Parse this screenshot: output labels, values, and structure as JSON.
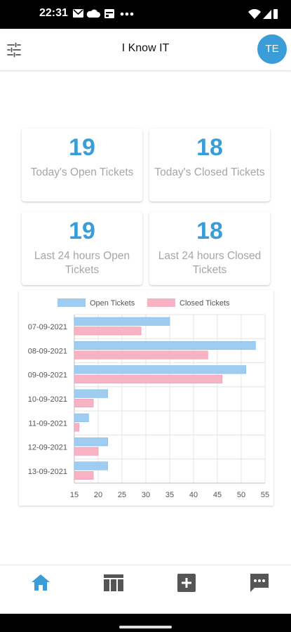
{
  "status_bar": {
    "time": "22:31"
  },
  "app_bar": {
    "title": "I Know IT",
    "avatar_initials": "TE"
  },
  "stats": [
    {
      "value": "19",
      "label": "Today's Open Tickets"
    },
    {
      "value": "18",
      "label": "Today's Closed Tickets"
    },
    {
      "value": "19",
      "label": "Last 24 hours Open Tickets"
    },
    {
      "value": "18",
      "label": "Last 24 hours Closed Tickets"
    }
  ],
  "colors": {
    "accent": "#3a9dd8",
    "open_series": "#9fcdf2",
    "closed_series": "#f7b2c4"
  },
  "icons": {
    "filter": "sliders-icon",
    "home": "home-icon",
    "table": "table-icon",
    "add": "plus-box-icon",
    "chat": "message-icon"
  },
  "chart_data": {
    "type": "bar",
    "orientation": "horizontal",
    "categories": [
      "07-09-2021",
      "08-09-2021",
      "09-09-2021",
      "10-09-2021",
      "11-09-2021",
      "12-09-2021",
      "13-09-2021"
    ],
    "series": [
      {
        "name": "Open Tickets",
        "color": "#9fcdf2",
        "values": [
          35,
          53,
          51,
          22,
          18,
          22,
          22
        ]
      },
      {
        "name": "Closed Tickets",
        "color": "#f7b2c4",
        "values": [
          29,
          43,
          46,
          19,
          16,
          20,
          19
        ]
      }
    ],
    "x_ticks": [
      15,
      20,
      25,
      30,
      35,
      40,
      45,
      50,
      55
    ],
    "xlim": [
      15,
      55
    ],
    "legend_position": "top",
    "grid": true
  }
}
